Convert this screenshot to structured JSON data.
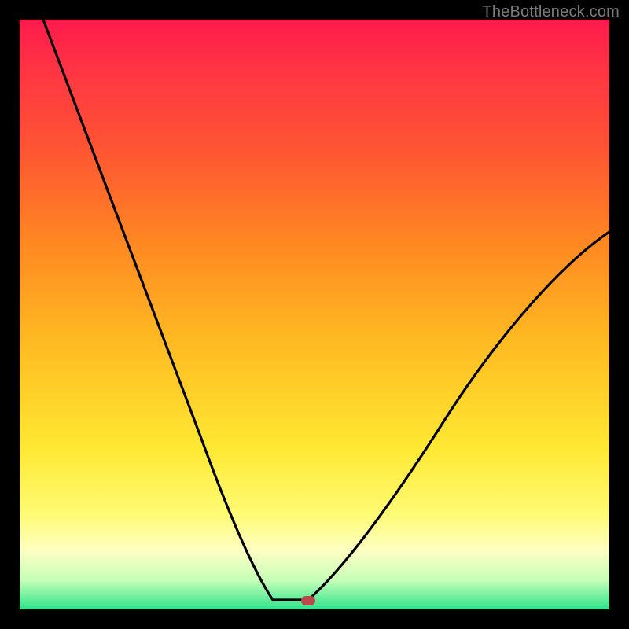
{
  "watermark": "TheBottleneck.com",
  "colors": {
    "curve_stroke": "#000000",
    "marker_fill": "#b94a4a",
    "frame_bg": "#000000"
  },
  "chart_data": {
    "type": "line",
    "title": "",
    "xlabel": "",
    "ylabel": "",
    "xlim": [
      0,
      100
    ],
    "ylim": [
      0,
      100
    ],
    "left_branch": {
      "start": [
        4,
        100
      ],
      "end": [
        43,
        1.5
      ]
    },
    "flat_segment": {
      "start": [
        43,
        1.5
      ],
      "end": [
        49,
        1.5
      ]
    },
    "right_branch": {
      "start": [
        49,
        1.5
      ],
      "end": [
        100,
        64
      ]
    },
    "marker": {
      "x": 49,
      "y": 1.5
    },
    "series": [
      {
        "name": "bottleneck-curve",
        "x": [
          4,
          10,
          16,
          22,
          28,
          34,
          40,
          43,
          46,
          49,
          55,
          62,
          70,
          78,
          86,
          94,
          100
        ],
        "y": [
          100,
          86,
          72,
          58,
          44,
          30,
          14,
          1.5,
          1.5,
          1.5,
          5,
          12,
          22,
          33,
          44,
          55,
          64
        ]
      }
    ]
  }
}
